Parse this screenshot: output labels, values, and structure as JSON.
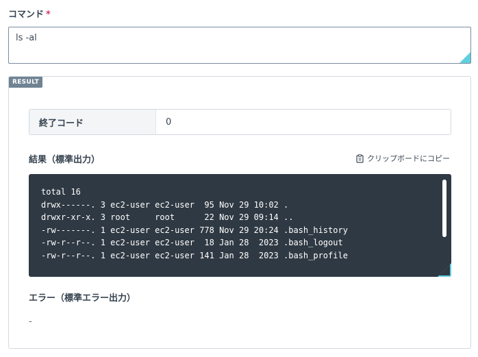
{
  "command": {
    "label": "コマンド",
    "required_mark": "*",
    "value": "ls -al"
  },
  "result": {
    "badge": "RESULT",
    "exit_code_label": "終了コード",
    "exit_code_value": "0",
    "stdout_label": "結果（標準出力）",
    "copy_label": "クリップボードにコピー",
    "stdout": "total 16\ndrwx------. 3 ec2-user ec2-user  95 Nov 29 10:02 .\ndrwxr-xr-x. 3 root     root      22 Nov 29 09:14 ..\n-rw-------. 1 ec2-user ec2-user 778 Nov 29 20:24 .bash_history\n-rw-r--r--. 1 ec2-user ec2-user  18 Jan 28  2023 .bash_logout\n-rw-r--r--. 1 ec2-user ec2-user 141 Jan 28  2023 .bash_profile",
    "stderr_label": "エラー（標準エラー出力）",
    "stderr_value": "-"
  },
  "icons": {
    "copy": "clipboard-icon"
  },
  "colors": {
    "accent": "#5fd0e0",
    "terminal_bg": "#2f3943",
    "badge_bg": "#6f8393",
    "required": "#d6336c"
  }
}
